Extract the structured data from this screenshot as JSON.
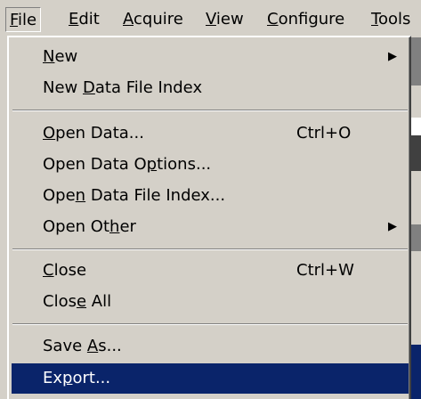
{
  "menubar": {
    "items": [
      {
        "pre": "",
        "accel": "F",
        "post": "ile"
      },
      {
        "pre": "",
        "accel": "E",
        "post": "dit"
      },
      {
        "pre": "",
        "accel": "A",
        "post": "cquire"
      },
      {
        "pre": "",
        "accel": "V",
        "post": "iew"
      },
      {
        "pre": "",
        "accel": "C",
        "post": "onfigure"
      },
      {
        "pre": "",
        "accel": "T",
        "post": "ools"
      }
    ]
  },
  "menu": {
    "items": [
      {
        "pre": "",
        "accel": "N",
        "post": "ew",
        "shortcut": "",
        "submenu": "▶"
      },
      {
        "pre": "New ",
        "accel": "D",
        "post": "ata File Index",
        "shortcut": "",
        "submenu": ""
      },
      {
        "pre": "",
        "accel": "O",
        "post": "pen Data...",
        "shortcut": "Ctrl+O",
        "submenu": ""
      },
      {
        "pre": "Open Data O",
        "accel": "p",
        "post": "tions...",
        "shortcut": "",
        "submenu": ""
      },
      {
        "pre": "Ope",
        "accel": "n",
        "post": " Data File Index...",
        "shortcut": "",
        "submenu": ""
      },
      {
        "pre": "Open Ot",
        "accel": "h",
        "post": "er",
        "shortcut": "",
        "submenu": "▶"
      },
      {
        "pre": "",
        "accel": "C",
        "post": "lose",
        "shortcut": "Ctrl+W",
        "submenu": ""
      },
      {
        "pre": "Clos",
        "accel": "e",
        "post": " All",
        "shortcut": "",
        "submenu": ""
      },
      {
        "pre": "Save ",
        "accel": "A",
        "post": "s...",
        "shortcut": "",
        "submenu": ""
      },
      {
        "pre": "Ex",
        "accel": "p",
        "post": "ort...",
        "shortcut": "",
        "submenu": ""
      }
    ]
  },
  "colors": {
    "face": "#d4d0c8",
    "highlight": "#0a246a",
    "highlight_text": "#ffffff"
  }
}
